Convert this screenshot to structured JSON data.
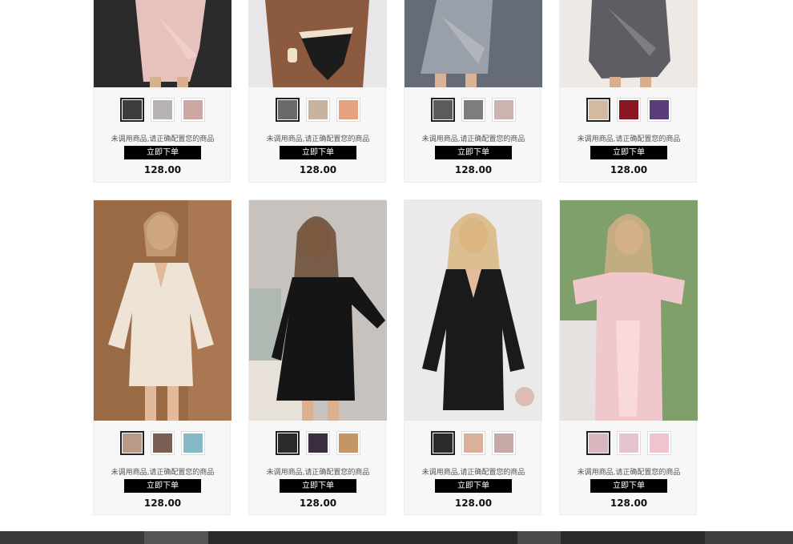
{
  "products": [
    {
      "message": "未调用商品,请正确配置您的商品",
      "button": "立即下单",
      "price": "128.00",
      "photo": {
        "bg": "#2b2b2b",
        "dress": "#e7c2bd",
        "skin": "#d8b08e",
        "accent": "#f3d7d1"
      },
      "swatches": [
        "#3c3c3c",
        "#b7b2b4",
        "#cfa7a2"
      ]
    },
    {
      "message": "未调用商品,请正确配置您的商品",
      "button": "立即下单",
      "price": "128.00",
      "photo": {
        "bg": "#e9e6ea",
        "dress": "#1c1c1c",
        "skin": "#8c5b3f",
        "accent": "#efe2cb"
      },
      "swatches": [
        "#6a6a6a",
        "#c8b39f",
        "#e5a27f"
      ]
    },
    {
      "message": "未调用商品,请正确配置您的商品",
      "button": "立即下单",
      "price": "128.00",
      "photo": {
        "bg": "#656c78",
        "dress": "#9aa0aa",
        "skin": "#d9b395",
        "accent": "#b8bcc4"
      },
      "swatches": [
        "#5b5b5b",
        "#7d7d7d",
        "#cab4b0"
      ]
    },
    {
      "message": "未调用商品,请正确配置您的商品",
      "button": "立即下单",
      "price": "128.00",
      "photo": {
        "bg": "#efe9e6",
        "dress": "#5d5d63",
        "skin": "#d7ae8e",
        "accent": "#8b8b92"
      },
      "swatches": [
        "#d4b9a2",
        "#8a1621",
        "#5a3c7a"
      ]
    },
    {
      "message": "未调用商品,请正确配置您的商品",
      "button": "立即下单",
      "price": "128.00",
      "photo": {
        "bg": "#9a6a45",
        "dress": "#efe3d6",
        "skin": "#e2b99a",
        "accent": "#c8b9a8"
      },
      "swatches": [
        "#b89a86",
        "#7b5f55",
        "#86b9c5"
      ]
    },
    {
      "message": "未调用商品,请正确配置您的商品",
      "button": "立即下单",
      "price": "128.00",
      "photo": {
        "bg": "#c7c2bd",
        "dress": "#151515",
        "skin": "#dcb192",
        "accent": "#6c6c6c"
      },
      "swatches": [
        "#2a2a2a",
        "#3a2d3f",
        "#c49566"
      ]
    },
    {
      "message": "未调用商品,请正确配置您的商品",
      "button": "立即下单",
      "price": "128.00",
      "photo": {
        "bg": "#ebe9e9",
        "dress": "#1a1a1a",
        "skin": "#e3bc9d",
        "accent": "#d7b3a6"
      },
      "swatches": [
        "#2a2a2a",
        "#d9b09a",
        "#c6a8a6"
      ]
    },
    {
      "message": "未调用商品,请正确配置您的商品",
      "button": "立即下单",
      "price": "128.00",
      "photo": {
        "bg": "#7fa06a",
        "dress": "#f0c8cc",
        "skin": "#e6bd9f",
        "accent": "#fde0e3"
      },
      "swatches": [
        "#d7b7bd",
        "#e5c4cd",
        "#f0c3cd"
      ]
    }
  ]
}
